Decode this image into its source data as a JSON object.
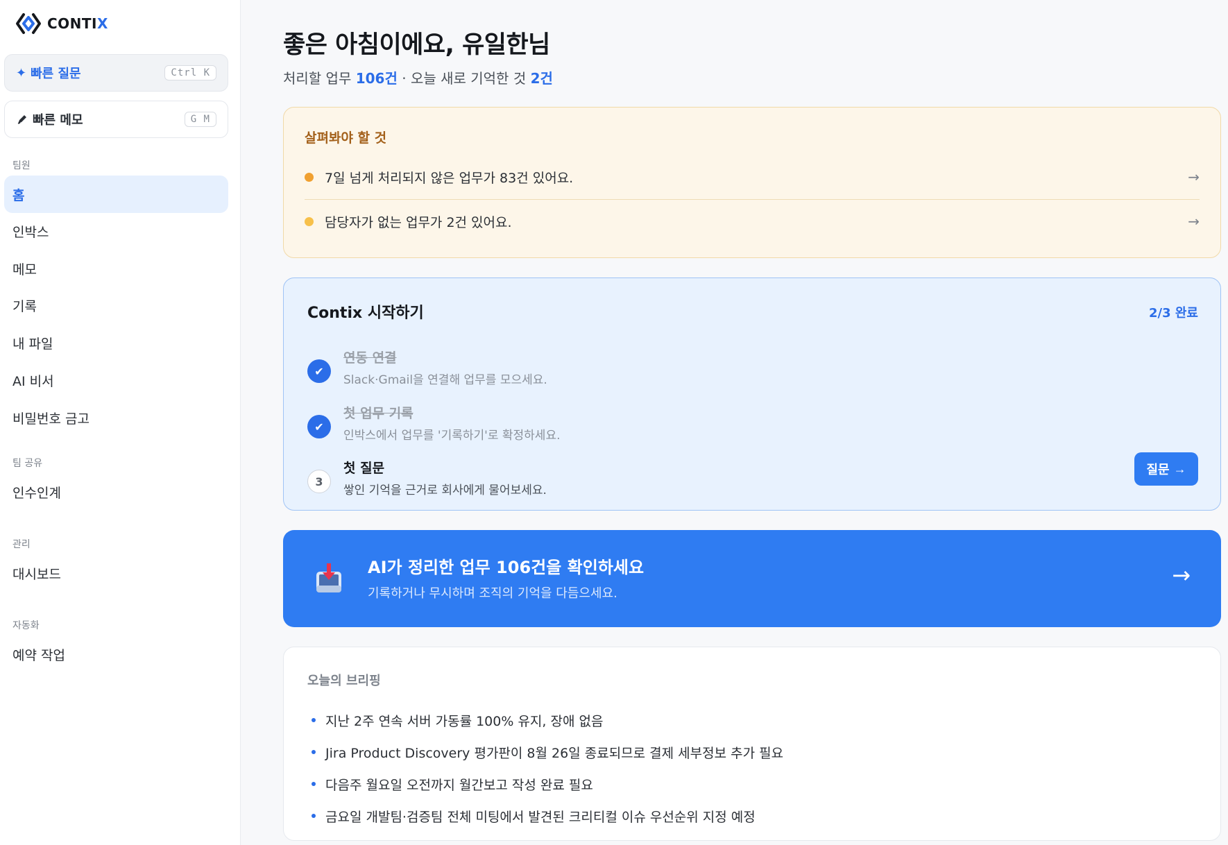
{
  "brand": {
    "name_main": "CONTI",
    "name_accent": "X"
  },
  "quick_actions": [
    {
      "label": "빠른 질문",
      "icon": "sparkle-icon",
      "shortcut": "Ctrl K"
    },
    {
      "label": "빠른 메모",
      "icon": "pencil-icon",
      "shortcut": "G M"
    }
  ],
  "sidebar": {
    "sections": [
      {
        "label": "팀원",
        "items": [
          "홈",
          "인박스",
          "메모",
          "기록",
          "내 파일",
          "AI 비서",
          "비밀번호 금고"
        ]
      },
      {
        "label": "팀 공유",
        "items": [
          "인수인계"
        ]
      },
      {
        "label": "관리",
        "items": [
          "대시보드"
        ]
      },
      {
        "label": "자동화",
        "items": [
          "예약 작업"
        ]
      }
    ],
    "active_item": "홈"
  },
  "header": {
    "greeting": "좋은 아침이에요, 유일한님",
    "sub_prefix": "처리할 업무 ",
    "pending_count": "106건",
    "sub_middle": " · 오늘 새로 기억한 것 ",
    "memory_count": "2건"
  },
  "attention": {
    "title": "살펴봐야 할 것",
    "items": [
      {
        "text": "7일 넘게 처리되지 않은 업무가 83건 있어요.",
        "dot_color": "#f0a030"
      },
      {
        "text": "담당자가 없는 업무가 2건 있어요.",
        "dot_color": "#f7c04a"
      }
    ]
  },
  "onboarding": {
    "title": "Contix 시작하기",
    "progress": "2/3 완료",
    "steps": [
      {
        "number": "1",
        "title": "연동 연결",
        "desc": "Slack·Gmail을 연결해 업무를 모으세요.",
        "done": true
      },
      {
        "number": "2",
        "title": "첫 업무 기록",
        "desc": "인박스에서 업무를 '기록하기'로 확정하세요.",
        "done": true
      },
      {
        "number": "3",
        "title": "첫 질문",
        "desc": "쌓인 기억을 근거로 회사에게 물어보세요.",
        "done": false
      }
    ],
    "action_label": "질문"
  },
  "banner": {
    "title": "AI가 정리한 업무 106건을 확인하세요",
    "desc": "기록하거나 무시하며 조직의 기억을 다듬으세요."
  },
  "briefing": {
    "title": "오늘의 브리핑",
    "items": [
      "지난 2주 연속 서버 가동률 100% 유지, 장애 없음",
      "Jira Product Discovery 평가판이 8월 26일 종료되므로 결제 세부정보 추가 필요",
      "다음주 월요일 오전까지 월간보고 작성 완료 필요",
      "금요일 개발팀·검증팀 전체 미팅에서 발견된 크리티컬 이슈 우선순위 지정 예정"
    ]
  },
  "colors": {
    "accent": "#2b6de8",
    "banner": "#2f7cf2",
    "warning_title": "#a3601a"
  }
}
